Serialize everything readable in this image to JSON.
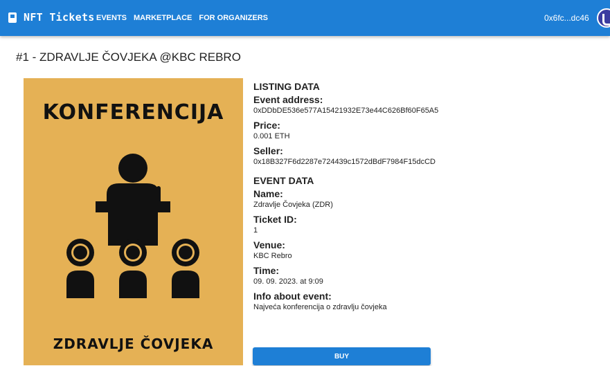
{
  "app": {
    "brand": "NFT Tickets",
    "nav": [
      "EVENTS",
      "MARKETPLACE",
      "FOR ORGANIZERS"
    ],
    "account": "0x6fc...dc46",
    "accent": "#1e7fd6"
  },
  "page": {
    "title": "#1 - ZDRAVLJE ČOVJEKA @KBC REBRO"
  },
  "poster": {
    "heading": "KONFERENCIJA",
    "footer": "ZDRAVLJE ČOVJEKA",
    "background": "#e5b155",
    "icon": "conference-speaker-icon"
  },
  "listing": {
    "section": "LISTING DATA",
    "event_address_label": "Event address:",
    "event_address": "0xDDbDE536e577A15421932E73e44C626Bf60F65A5",
    "price_label": "Price:",
    "price": "0.001 ETH",
    "seller_label": "Seller:",
    "seller": "0x18B327F6d2287e724439c1572dBdF7984F15dcCD"
  },
  "event": {
    "section": "EVENT DATA",
    "name_label": "Name:",
    "name": "Zdravlje Čovjeka (ZDR)",
    "ticket_label": "Ticket ID:",
    "ticket_id": "1",
    "venue_label": "Venue:",
    "venue": "KBC Rebro",
    "time_label": "Time:",
    "time": "09. 09. 2023. at 9:09",
    "info_label": "Info about event:",
    "info": "Najveća konferencija o zdravlju čovjeka"
  },
  "actions": {
    "buy_label": "BUY"
  }
}
